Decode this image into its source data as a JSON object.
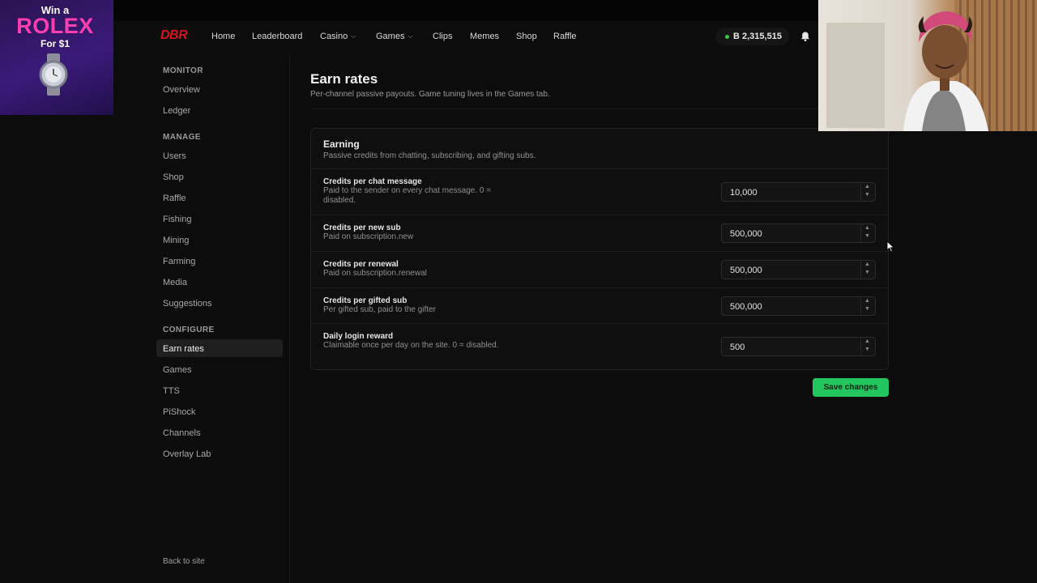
{
  "ad": {
    "line1": "Win a",
    "brand": "ROLEX",
    "line3": "For $1"
  },
  "nav": {
    "logo": "DBR",
    "items": [
      {
        "label": "Home",
        "dropdown": false
      },
      {
        "label": "Leaderboard",
        "dropdown": false
      },
      {
        "label": "Casino",
        "dropdown": true
      },
      {
        "label": "Games",
        "dropdown": true
      },
      {
        "label": "Clips",
        "dropdown": false
      },
      {
        "label": "Memes",
        "dropdown": false
      },
      {
        "label": "Shop",
        "dropdown": false
      },
      {
        "label": "Raffle",
        "dropdown": false
      }
    ],
    "balance": "B 2,315,515",
    "balance_status_color": "#2ecc40"
  },
  "sidebar": {
    "sections": [
      {
        "heading": "MONITOR",
        "items": [
          "Overview",
          "Ledger"
        ]
      },
      {
        "heading": "MANAGE",
        "items": [
          "Users",
          "Shop",
          "Raffle",
          "Fishing",
          "Mining",
          "Farming",
          "Media",
          "Suggestions"
        ]
      },
      {
        "heading": "CONFIGURE",
        "items": [
          "Earn rates",
          "Games",
          "TTS",
          "PiShock",
          "Channels",
          "Overlay Lab"
        ]
      }
    ],
    "active": "Earn rates",
    "back": "Back to site"
  },
  "page": {
    "title": "Earn rates",
    "subtitle": "Per-channel passive payouts. Game tuning lives in the Games tab."
  },
  "card": {
    "title": "Earning",
    "subtitle": "Passive credits from chatting, subscribing, and gifting subs.",
    "rows": [
      {
        "label": "Credits per chat message",
        "help": "Paid to the sender on every chat message. 0 = disabled.",
        "value": "10,000"
      },
      {
        "label": "Credits per new sub",
        "help": "Paid on subscription.new",
        "value": "500,000"
      },
      {
        "label": "Credits per renewal",
        "help": "Paid on subscription.renewal",
        "value": "500,000"
      },
      {
        "label": "Credits per gifted sub",
        "help": "Per gifted sub, paid to the gifter",
        "value": "500,000"
      },
      {
        "label": "Daily login reward",
        "help": "Claimable once per day on the site. 0 = disabled.",
        "value": "500"
      }
    ]
  },
  "save_label": "Save changes",
  "colors": {
    "accent": "#22c55e",
    "logo": "#d4141a",
    "background": "#0c0c0c"
  }
}
